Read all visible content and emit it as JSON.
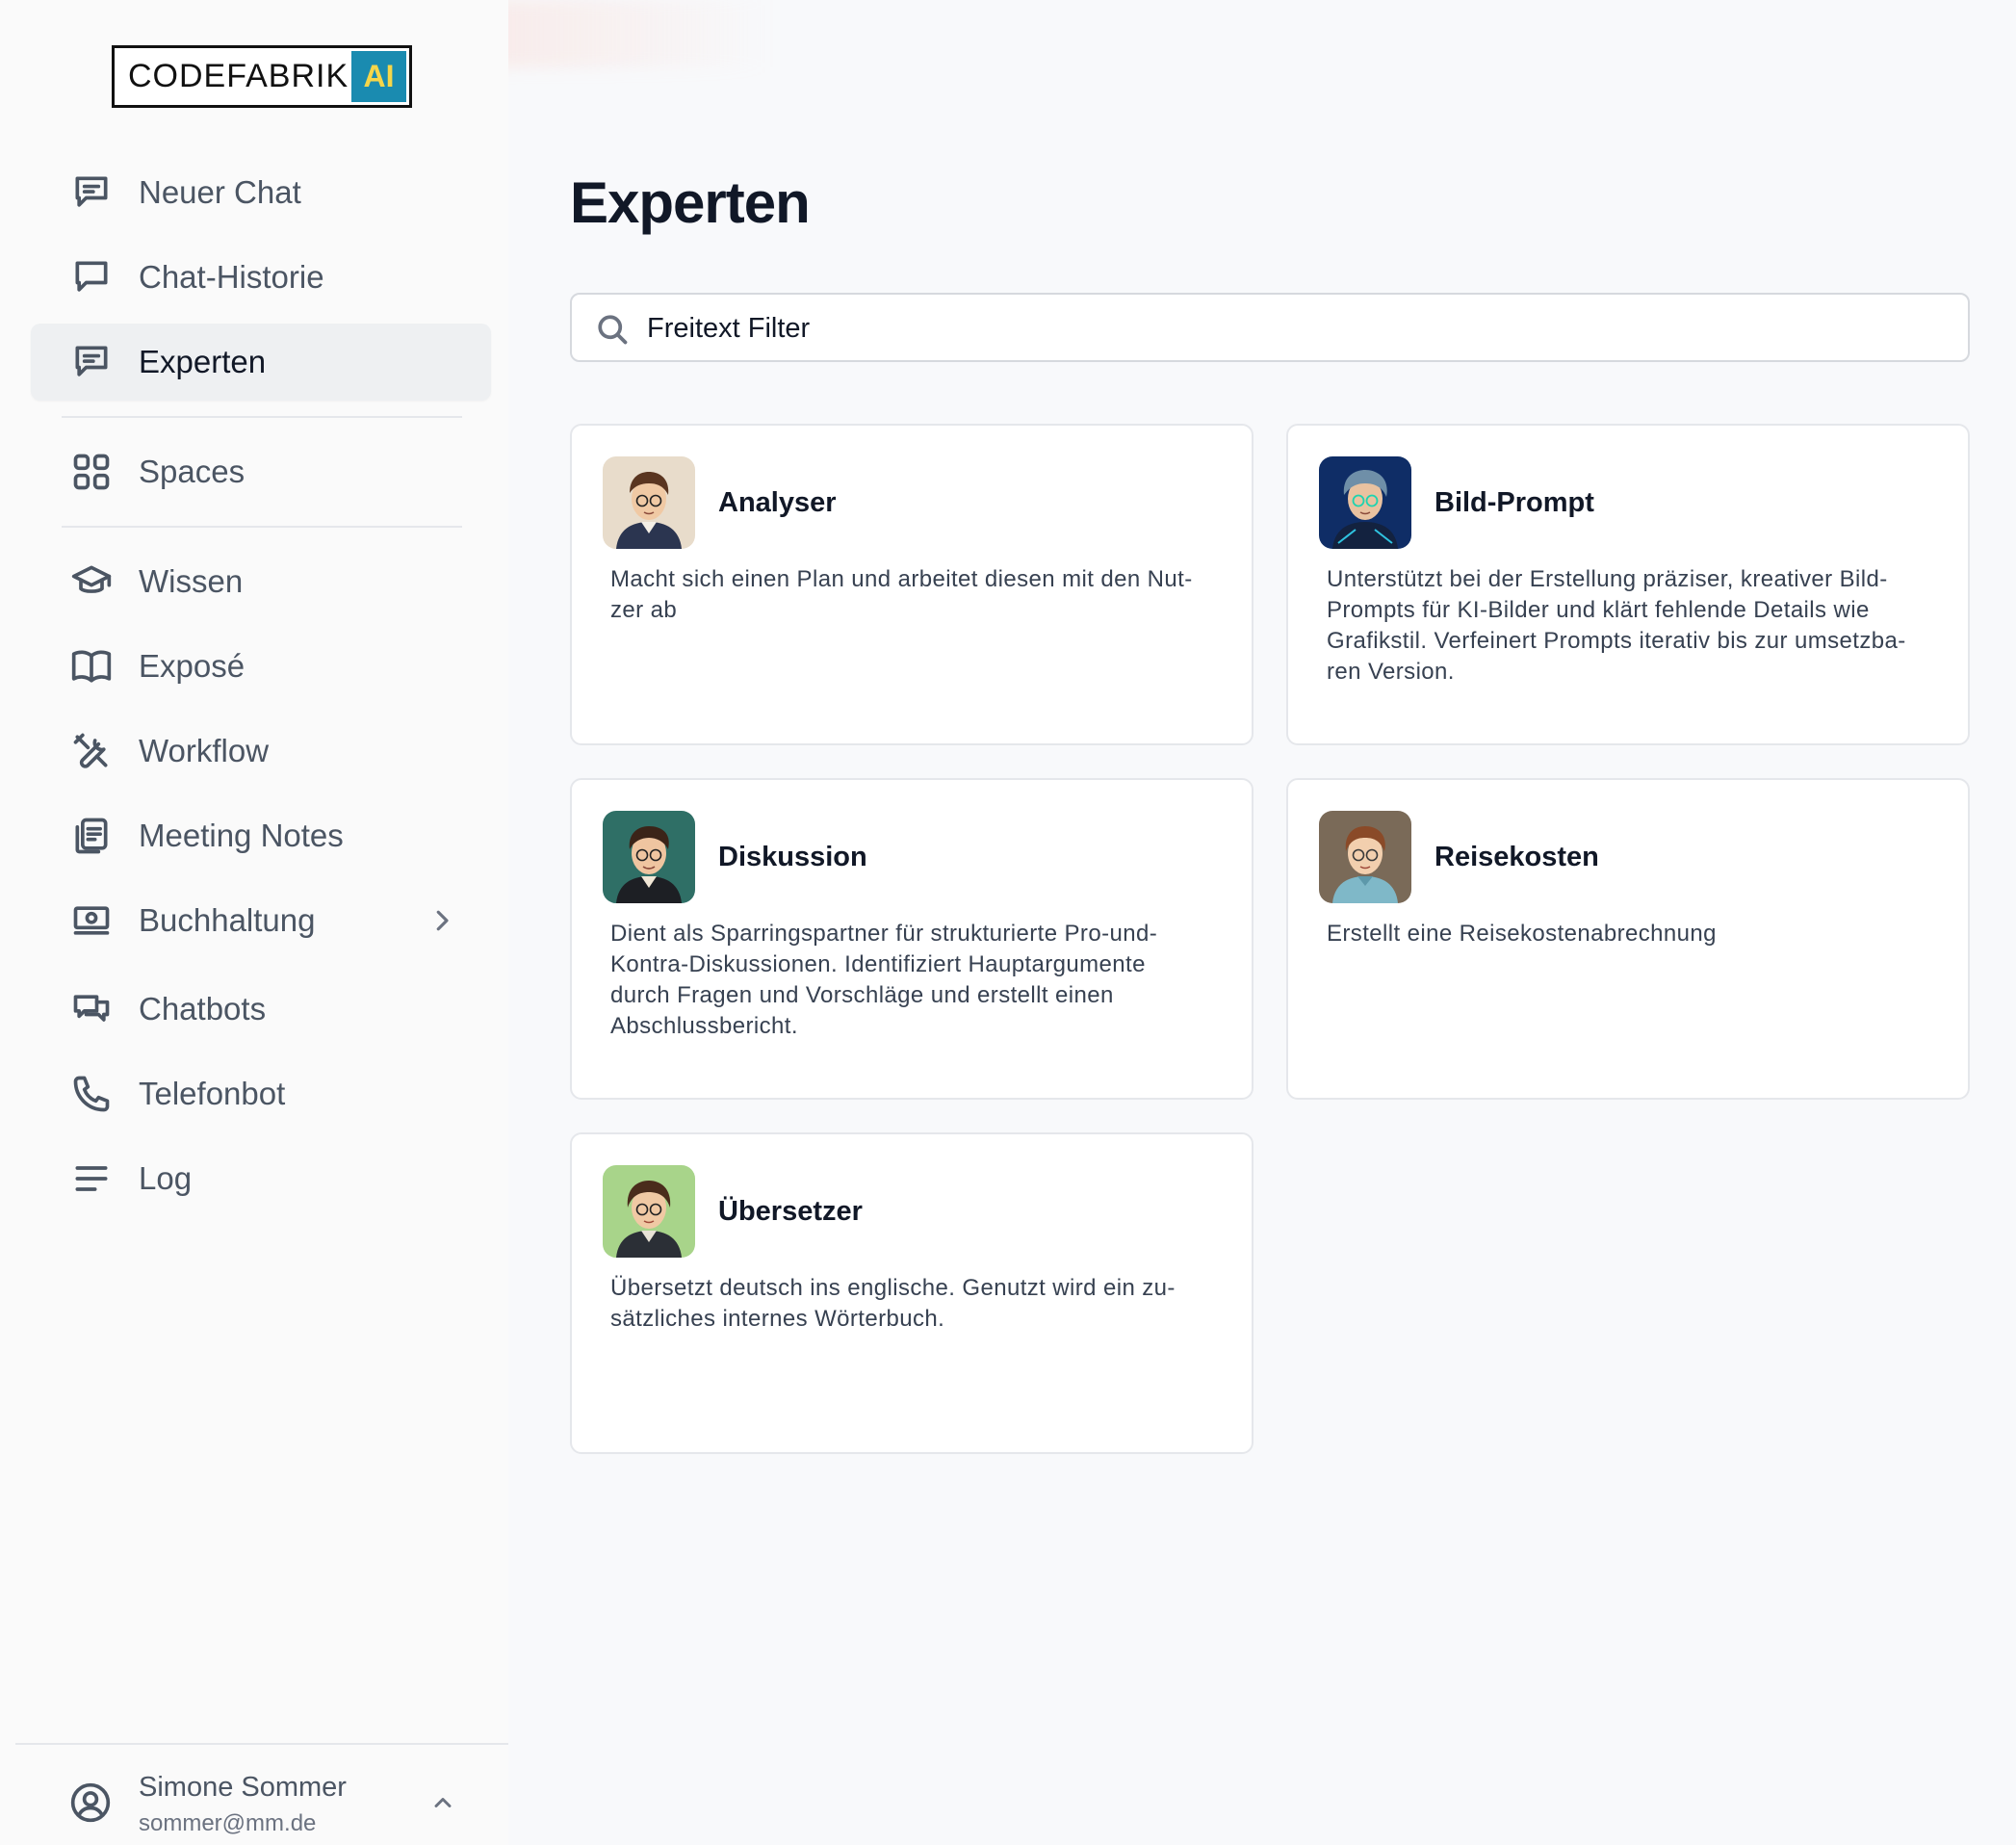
{
  "logo": {
    "text": "CODEFABRIK",
    "badge": "AI",
    "badge_bg": "#1a8bb0",
    "badge_fg": "#f5d64a"
  },
  "sidebar": {
    "items": [
      {
        "label": "Neuer Chat",
        "icon": "chat-text-icon"
      },
      {
        "label": "Chat-Historie",
        "icon": "chat-bubble-icon"
      },
      {
        "label": "Experten",
        "icon": "chat-text-icon",
        "active": true
      },
      {
        "label": "Spaces",
        "icon": "grid-icon"
      },
      {
        "label": "Wissen",
        "icon": "graduation-cap-icon"
      },
      {
        "label": "Exposé",
        "icon": "book-icon"
      },
      {
        "label": "Workflow",
        "icon": "tools-icon"
      },
      {
        "label": "Meeting Notes",
        "icon": "clipboard-icon"
      },
      {
        "label": "Buchhaltung",
        "icon": "banknote-icon",
        "has_submenu": true
      },
      {
        "label": "Chatbots",
        "icon": "chats-icon"
      },
      {
        "label": "Telefonbot",
        "icon": "phone-icon"
      },
      {
        "label": "Log",
        "icon": "lines-icon"
      }
    ]
  },
  "user": {
    "name": "Simone Sommer",
    "email": "sommer@mm.de"
  },
  "main": {
    "title": "Experten",
    "search": {
      "placeholder": "Freitext Filter",
      "value": ""
    },
    "experts": [
      {
        "title": "Analyser",
        "description": "Macht sich einen Plan und arbeitet diesen mit den Nut-\nzer ab",
        "avatar_bg": "#e8dccb"
      },
      {
        "title": "Bild-Prompt",
        "description": "Unterstützt bei der Erstellung präziser, kreativer Bild-\nPrompts für KI-Bilder und klärt fehlende Details wie\nGrafikstil. Verfeinert Prompts iterativ bis zur umsetzba-\nren Version.",
        "avatar_bg": "#0f2d66"
      },
      {
        "title": "Diskussion",
        "description": "Dient als Sparringspartner für strukturierte Pro-und-\nKontra-Diskussionen. Identifiziert Hauptargumente\ndurch Fragen und Vorschläge und erstellt einen\nAbschlussbericht.",
        "avatar_bg": "#2f6f66"
      },
      {
        "title": "Reisekosten",
        "description": "Erstellt eine Reisekostenabrechnung",
        "avatar_bg": "#7a6a58"
      },
      {
        "title": "Übersetzer",
        "description": "Übersetzt deutsch ins englische. Genutzt wird ein zu-\nsätzliches internes Wörterbuch.",
        "avatar_bg": "#a8d48a"
      }
    ]
  }
}
